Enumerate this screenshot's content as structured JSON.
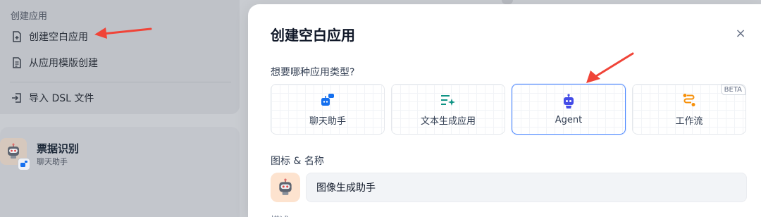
{
  "sidebar": {
    "section_title": "创建应用",
    "items": [
      {
        "label": "创建空白应用",
        "icon": "file-plus-icon"
      },
      {
        "label": "从应用模版创建",
        "icon": "file-template-icon"
      },
      {
        "label": "导入 DSL 文件",
        "icon": "import-icon"
      }
    ]
  },
  "app_card": {
    "name": "票据识别",
    "type": "聊天助手",
    "avatar": "robot-icon"
  },
  "modal": {
    "title": "创建空白应用",
    "close_symbol": "×",
    "type_question": "想要哪种应用类型?",
    "types": [
      {
        "label": "聊天助手",
        "icon": "chat-bot-icon",
        "color": "#1570ef"
      },
      {
        "label": "文本生成应用",
        "icon": "text-generate-icon",
        "color": "#0e9384"
      },
      {
        "label": "Agent",
        "icon": "agent-robot-icon",
        "color": "#444ce7",
        "selected": true
      },
      {
        "label": "工作流",
        "icon": "workflow-icon",
        "color": "#f79009",
        "badge": "BETA"
      }
    ],
    "icon_name_label": "图标 & 名称",
    "name_value": "图像生成助手",
    "desc_label_partial": "描述"
  },
  "colors": {
    "accent": "#528bff",
    "annotation_arrow": "#f04438"
  }
}
